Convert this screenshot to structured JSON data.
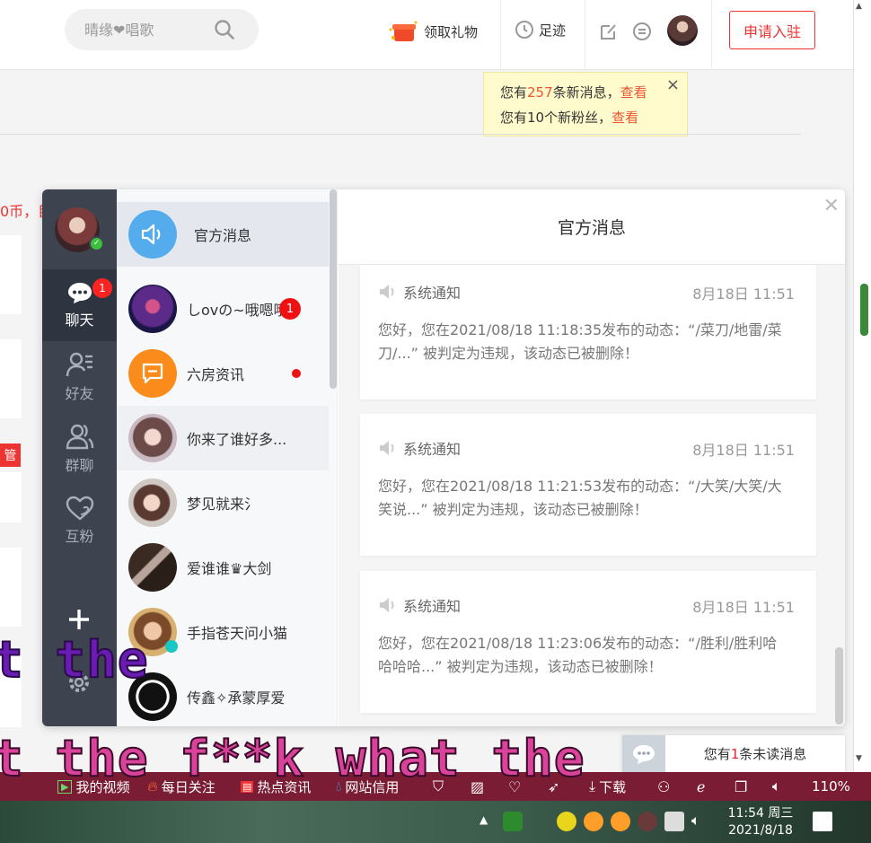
{
  "header": {
    "search_placeholder": "晴缘❤唱歌",
    "gift_label": "领取礼物",
    "trace_label": "足迹",
    "apply_label": "申请入驻"
  },
  "notice": {
    "line1_prefix": "您有",
    "line1_count": "257",
    "line1_suffix": "条新消息，",
    "line1_link": "查看",
    "line2_prefix": "您有10个新粉丝，",
    "line2_link": "查看",
    "close": "×"
  },
  "background": {
    "red_text": "0币，目",
    "tag": "管"
  },
  "chat": {
    "nav": [
      {
        "label": "聊天",
        "badge": "1"
      },
      {
        "label": "好友"
      },
      {
        "label": "群聊"
      },
      {
        "label": "互粉"
      }
    ],
    "conversations": [
      {
        "name": "官方消息"
      },
      {
        "name": "しovの~哦嗯哦",
        "badge": "1"
      },
      {
        "name": "六房资讯"
      },
      {
        "name": "你来了谁好多..."
      },
      {
        "name": "梦见就来氵"
      },
      {
        "name": "爱谁谁♛大剑"
      },
      {
        "name": "手指苍天问小猫"
      },
      {
        "name": "传鑫✧承蒙厚爱"
      }
    ],
    "panel_title": "官方消息",
    "messages": [
      {
        "sender": "系统通知",
        "time": "8月18日 11:51",
        "text": "您好，您在2021/08/18 11:18:35发布的动态：“/菜刀/地雷/菜刀/...” 被判定为违规，该动态已被删除！"
      },
      {
        "sender": "系统通知",
        "time": "8月18日 11:51",
        "text": "您好，您在2021/08/18 11:21:53发布的动态：“/大笑/大笑/大笑说...” 被判定为违规，该动态已被删除！"
      },
      {
        "sender": "系统通知",
        "time": "8月18日 11:51",
        "text": "您好，您在2021/08/18 11:23:06发布的动态：“/胜利/胜利哈哈哈哈...” 被判定为违规，该动态已被删除！"
      }
    ]
  },
  "unread": {
    "prefix": "您有",
    "count": "1",
    "suffix": "条未读消息"
  },
  "overlay": {
    "line1": "t the",
    "line2": "t the f**k what the"
  },
  "browser_toolbar": {
    "my_video": "我的视频",
    "daily_follow": "每日关注",
    "hot_news": "热点资讯",
    "site_credit": "网站信用",
    "download": "下载",
    "zoom": "110%"
  },
  "taskbar": {
    "time": "11:54 周三",
    "date": "2021/8/18"
  },
  "colors": {
    "accent_red": "#e33333",
    "nav_bg": "#3d4450",
    "toolbar_bg": "#7a1c34"
  }
}
